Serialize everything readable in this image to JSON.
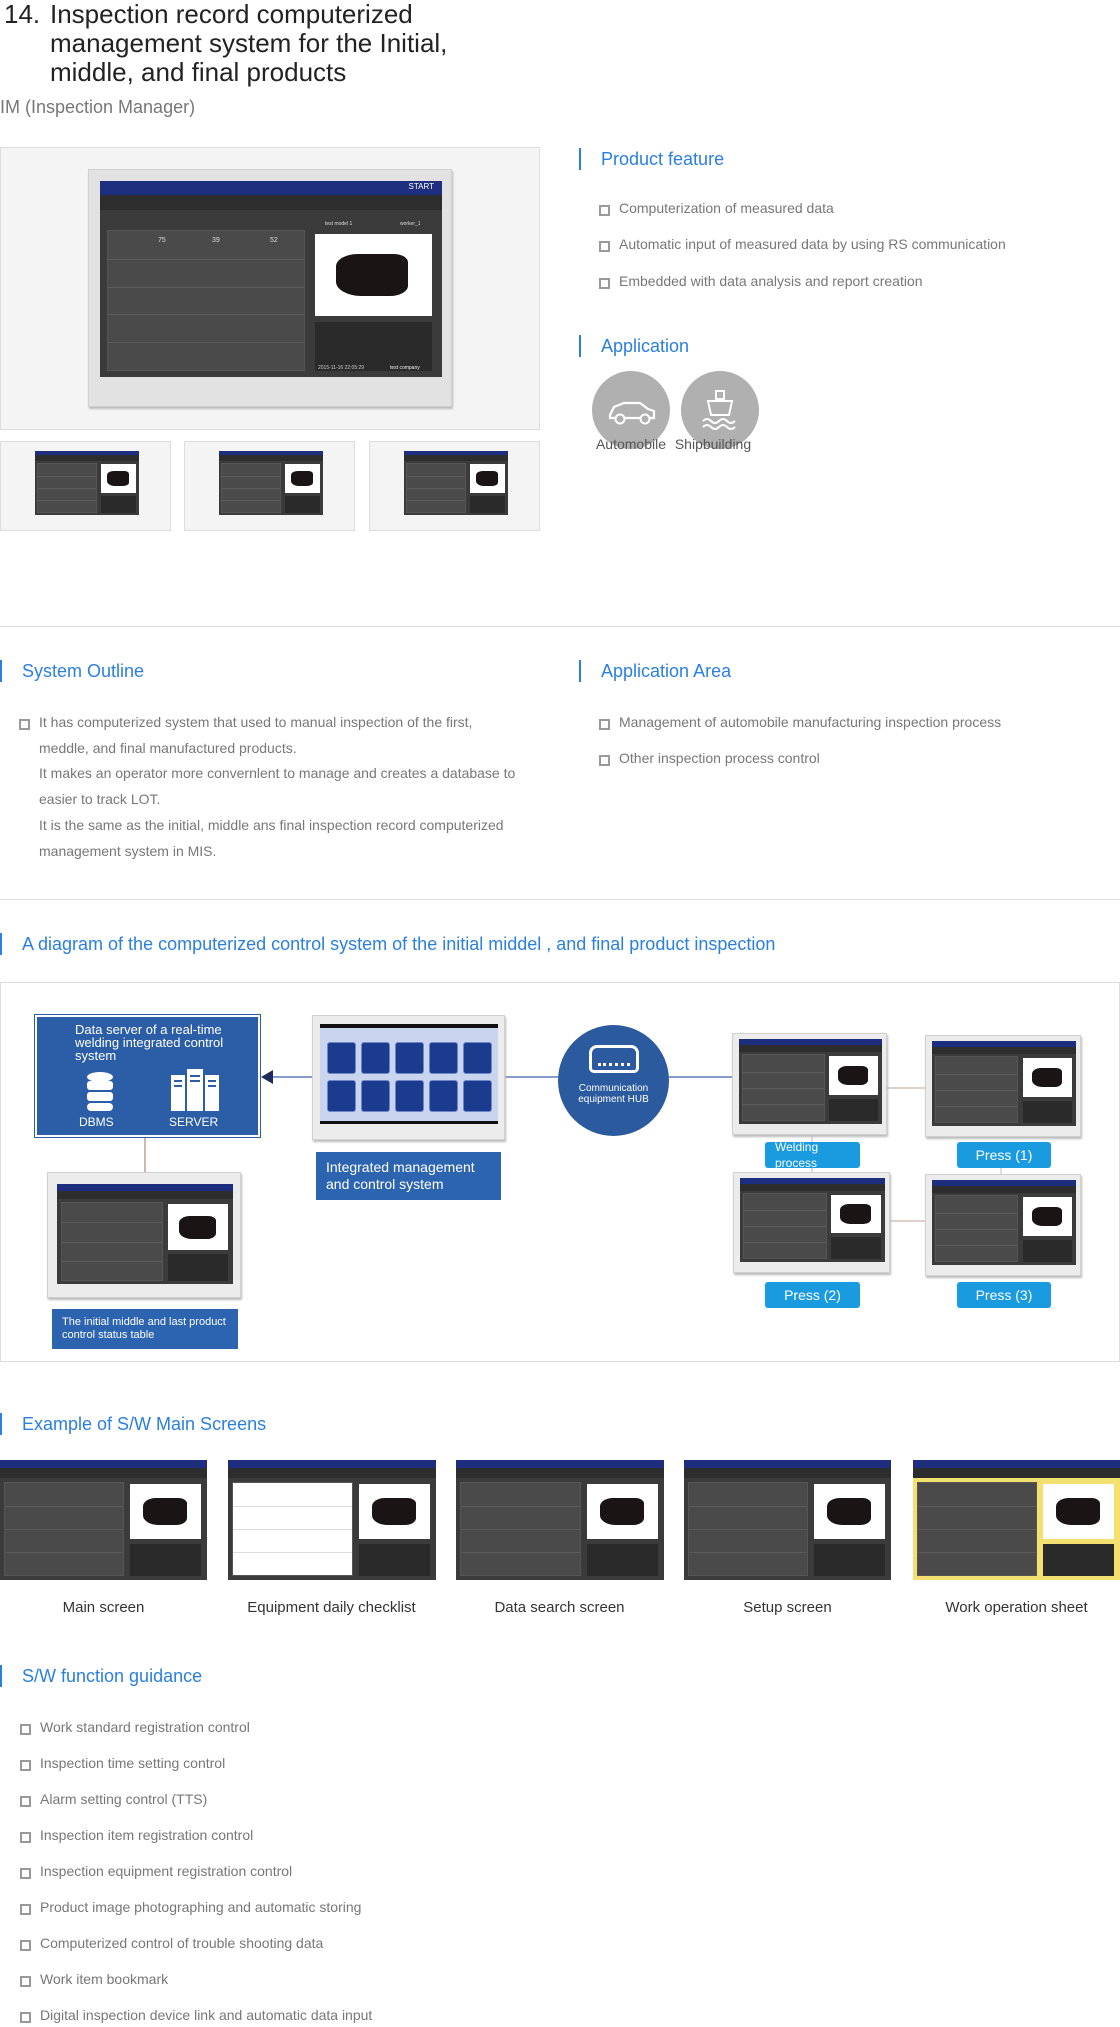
{
  "header": {
    "number": "14.",
    "title": "Inspection record computerized management system for the Initial, middle, and final products",
    "subtitle": "IM (Inspection Manager)"
  },
  "main_screen": {
    "start": "START",
    "counts": [
      "75",
      "39",
      "52"
    ],
    "model": "test model 1",
    "worker": "worker_1",
    "date": "2015-11-16  22:05:29",
    "company": "test company"
  },
  "product_feature": {
    "heading": "Product feature",
    "items": [
      "Computerization of measured data",
      "Automatic input of measured data by using RS communication",
      "Embedded with data analysis and report creation"
    ]
  },
  "application": {
    "heading": "Application",
    "items": [
      {
        "label": "Automobile",
        "icon": "car-icon"
      },
      {
        "label": "Shipbuilding",
        "icon": "ship-icon"
      }
    ]
  },
  "system_outline": {
    "heading": "System Outline",
    "lines": [
      "It has computerized system that used to manual inspection of the first,",
      "meddle, and final manufactured products.",
      "It makes an operator more convernlent to manage and creates a database to",
      "easier to track LOT.",
      "It is the same as the initial, middle ans final inspection record computerized",
      "management system in MIS."
    ]
  },
  "application_area": {
    "heading": "Application Area",
    "items": [
      "Management of automobile manufacturing inspection process",
      "Other inspection process control"
    ]
  },
  "diagram": {
    "heading": "A diagram of the computerized control system of the initial middel , and final product inspection",
    "server_title": "Data server of a real-time welding integrated control system",
    "dbms": "DBMS",
    "server": "SERVER",
    "integrated": "Integrated management and control system",
    "hub": "Communication equipment HUB",
    "status_table": "The initial middle and last product control status table",
    "stations": [
      "Welding process",
      "Press (1)",
      "Press (2)",
      "Press (3)"
    ],
    "colors": {
      "box": "#2b5ea6",
      "label": "#1a9be0"
    }
  },
  "screens": {
    "heading": "Example of S/W Main Screens",
    "items": [
      "Main screen",
      "Equipment daily checklist",
      "Data search screen",
      "Setup screen",
      "Work operation sheet"
    ]
  },
  "functions": {
    "heading": "S/W function guidance",
    "items": [
      "Work standard registration control",
      "Inspection time setting control",
      "Alarm setting control (TTS)",
      "Inspection item registration control",
      "Inspection equipment registration control",
      "Product image photographing and automatic storing",
      "Computerized control of trouble shooting data",
      "Work item bookmark",
      "Digital inspection device link and automatic data input"
    ]
  }
}
